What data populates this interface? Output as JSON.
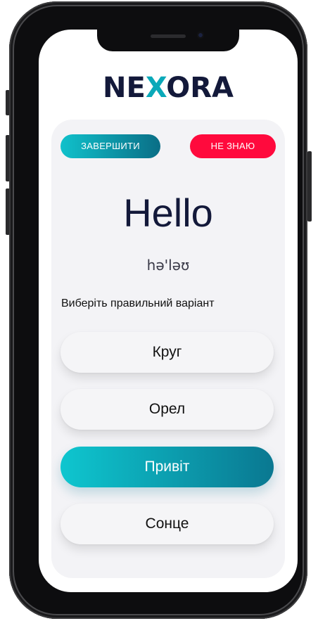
{
  "app": {
    "logo_prefix": "NE",
    "logo_x": "X",
    "logo_suffix": "ORA"
  },
  "quiz": {
    "finish_label": "ЗАВЕРШИТИ",
    "dont_know_label": "НЕ ЗНАЮ",
    "word": "Hello",
    "transcription": "hə'ləʊ",
    "prompt": "Виберіть правильний варіант",
    "options": [
      {
        "label": "Круг",
        "selected": false
      },
      {
        "label": "Орел",
        "selected": false
      },
      {
        "label": "Привіт",
        "selected": true
      },
      {
        "label": "Сонце",
        "selected": false
      }
    ]
  },
  "colors": {
    "brand_dark": "#13193a",
    "brand_accent": "#0aa9b9",
    "danger": "#ff0a3d",
    "gradient_start": "#10c1cb",
    "gradient_end": "#0a6e86"
  }
}
